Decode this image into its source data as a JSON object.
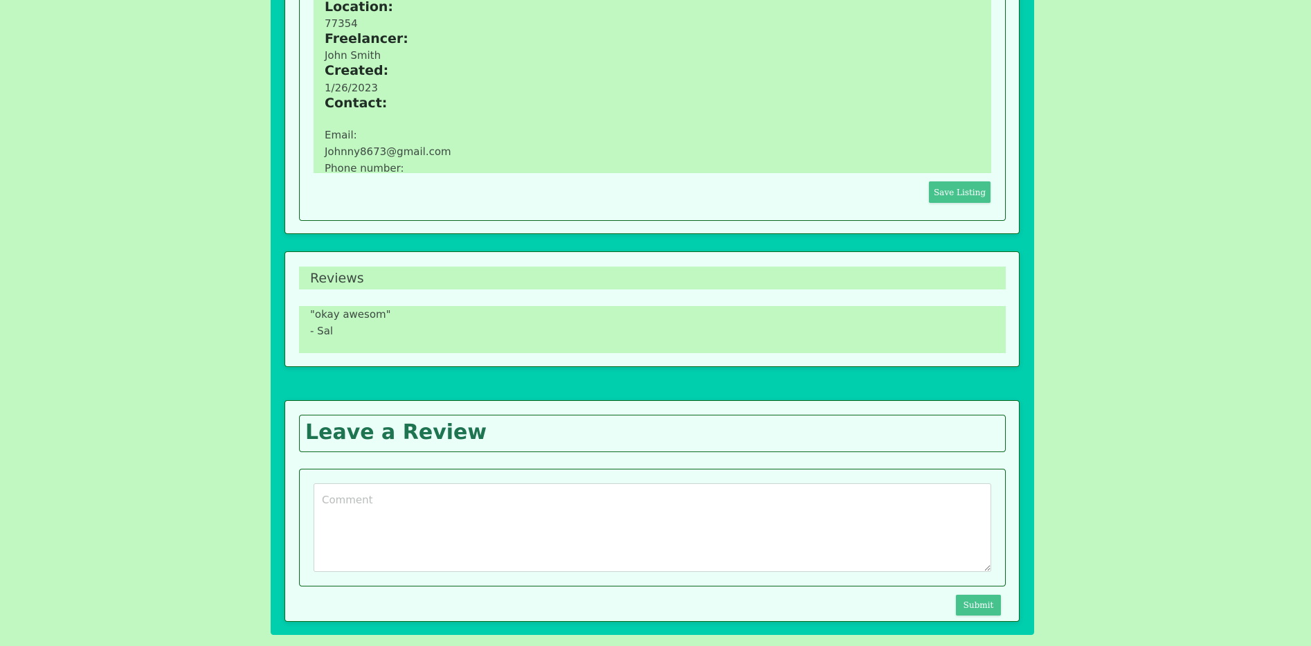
{
  "listing": {
    "location_label": "Location:",
    "location_value": "77354",
    "freelancer_label": "Freelancer:",
    "freelancer_value": "John Smith",
    "created_label": "Created:",
    "created_value": "1/26/2023",
    "contact_label": "Contact:",
    "email_label": "Email:",
    "email_value": "Johnny8673@gmail.com",
    "phone_label": "Phone number:",
    "save_button": "Save Listing"
  },
  "reviews": {
    "title": "Reviews",
    "items": [
      {
        "text": "\"okay awesom\"",
        "author": "- Sal"
      }
    ]
  },
  "leave_review": {
    "title": "Leave a Review",
    "comment_placeholder": "Comment",
    "submit_button": "Submit"
  },
  "colors": {
    "page_background": "#c1f7c0",
    "column_background": "#00cfae",
    "card_background": "#ebfff9",
    "accent_button": "#46c38d",
    "heading_green": "#1e7450"
  }
}
